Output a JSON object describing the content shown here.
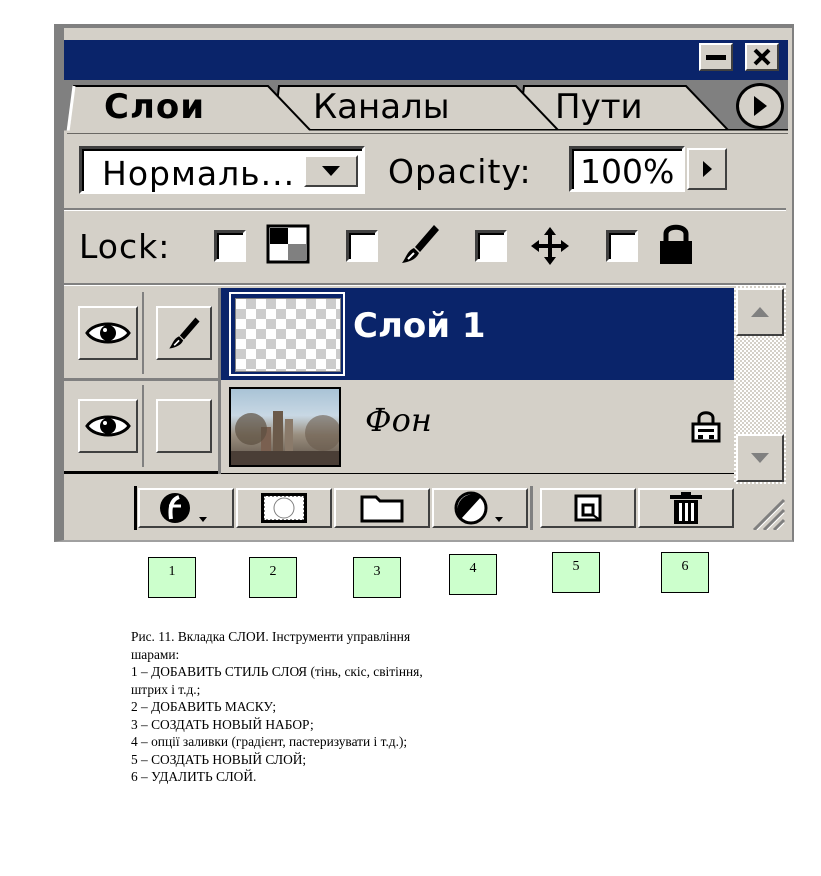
{
  "window": {
    "minimize_icon": "minimize-icon",
    "close_icon": "close-icon"
  },
  "tabs": [
    {
      "label": "Слои",
      "active": true
    },
    {
      "label": "Каналы",
      "active": false
    },
    {
      "label": "Пути",
      "active": false
    }
  ],
  "options": {
    "blend_mode": "Нормаль...",
    "opacity_label": "Opacity:",
    "opacity_value": "100%"
  },
  "lock": {
    "label": "Lock:",
    "items": [
      {
        "icon": "transparency-icon",
        "checked": false
      },
      {
        "icon": "brush-icon",
        "checked": false
      },
      {
        "icon": "move-icon",
        "checked": false
      },
      {
        "icon": "lock-icon",
        "checked": false
      }
    ]
  },
  "layers": [
    {
      "name": "Слой 1",
      "visible": true,
      "brush": true,
      "selected": true,
      "thumbnail": "transparent-thumbnail"
    },
    {
      "name": "Фон",
      "visible": true,
      "brush": false,
      "selected": false,
      "thumbnail": "photo-thumbnail",
      "locked": true
    }
  ],
  "toolbar": [
    {
      "icon": "layer-style-icon"
    },
    {
      "icon": "mask-icon"
    },
    {
      "icon": "folder-icon"
    },
    {
      "icon": "adjustment-layer-icon"
    },
    {
      "icon": "new-layer-icon"
    },
    {
      "icon": "trash-icon"
    }
  ],
  "markers": [
    "1",
    "2",
    "3",
    "4",
    "5",
    "6"
  ],
  "caption": [
    "Рис. 11. Вкладка СЛОИ. Інструменти управління шарами:",
    "1 – ДОБАВИТЬ СТИЛЬ СЛОЯ (тінь, скіс, світіння, штрих і т.д.;",
    "2 – ДОБАВИТЬ МАСКУ;",
    "3 – СОЗДАТЬ НОВЫЙ НАБОР;",
    "4 – опції заливки (градієнт, пастеризувати і т.д.);",
    "5 – СОЗДАТЬ НОВЫЙ СЛОЙ;",
    "6 – УДАЛИТЬ СЛОЙ."
  ],
  "colors": {
    "titlebar": "#0a246a",
    "selected_row": "#0a246a",
    "panel": "#d4d0c8",
    "marker_fill": "#ccffcc"
  }
}
